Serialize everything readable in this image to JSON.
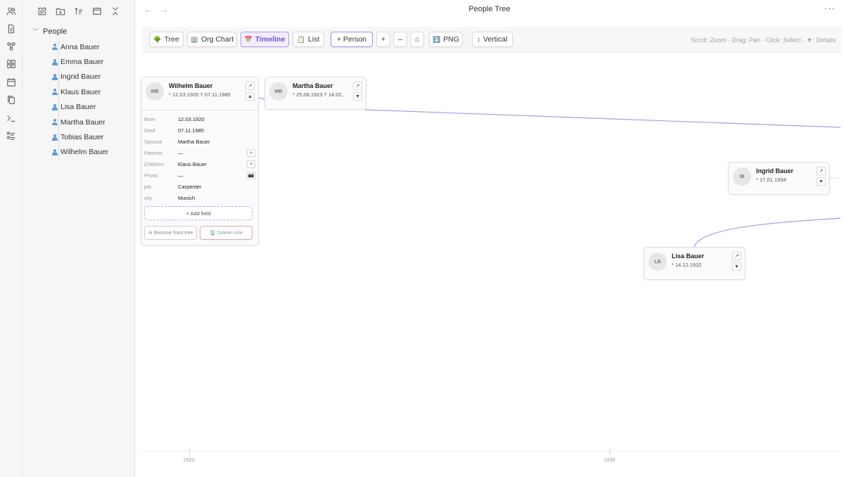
{
  "ribbon": {
    "icons": [
      "people-icon",
      "file-icon",
      "graph-icon",
      "grid-icon",
      "calendar-icon",
      "copy-icon",
      "terminal-icon",
      "list-icon"
    ]
  },
  "sidebar": {
    "tools": [
      "new-note-icon",
      "new-folder-icon",
      "sort-icon",
      "collapse-view-icon",
      "collapse-all-icon"
    ],
    "folder": {
      "name": "People",
      "expanded": true
    },
    "people": [
      "Anna Bauer",
      "Emma Bauer",
      "Ingrid Bauer",
      "Klaus Bauer",
      "Lisa Bauer",
      "Martha Bauer",
      "Tobias Bauer",
      "Wilhelm Bauer"
    ]
  },
  "header": {
    "back": "←",
    "forward": "→",
    "title": "People Tree",
    "more": "···"
  },
  "toolbar": {
    "tree": {
      "icon": "🌳",
      "label": "Tree"
    },
    "org_chart": {
      "icon": "🏢",
      "label": "Org Chart"
    },
    "timeline": {
      "icon": "📅",
      "label": "Timeline"
    },
    "list": {
      "icon": "📋",
      "label": "List"
    },
    "add_person": "+ Person",
    "zoom_in": "+",
    "zoom_out": "–",
    "home": "⌂",
    "png": {
      "icon": "⬇️",
      "label": "PNG"
    },
    "vertical": {
      "icon": "↕",
      "label": "Vertical"
    },
    "hint": "Scroll: Zoom · Drag: Pan · Click: Select · ▼: Details",
    "active_view": "Timeline",
    "accent_color": "#7c5ce0"
  },
  "cards": {
    "wilhelm": {
      "initials": "WB",
      "name": "Wilhelm Bauer",
      "dates": "* 12.03.1920 † 07.11.1985",
      "open": "↗",
      "toggle": "▲",
      "fields": {
        "born": {
          "label": "Born",
          "value": "12.03.1920"
        },
        "died": {
          "label": "Died",
          "value": "07.11.1985"
        },
        "spouse": {
          "label": "Spouse",
          "value": "Martha Bauer"
        },
        "parents": {
          "label": "Parents",
          "value": "—",
          "action": "+"
        },
        "children": {
          "label": "Children",
          "value": "Klaus Bauer",
          "action": "+"
        },
        "photo": {
          "label": "Photo",
          "value": "—",
          "action": "📷"
        },
        "job": {
          "label": "job",
          "value": "Carpenter"
        },
        "city": {
          "label": "city",
          "value": "Munich"
        }
      },
      "add_field": "+ Add field",
      "remove": "⊖ Remove from tree",
      "delete": "🗑️ Delete note"
    },
    "martha": {
      "initials": "MB",
      "name": "Martha Bauer",
      "dates": "* 25.08.1923 † 14.02...",
      "open": "↗",
      "toggle": "▼"
    },
    "ingrid": {
      "initials": "IB",
      "name": "Ingrid Bauer",
      "dates": "* 17.01.1934",
      "open": "↗",
      "toggle": "▼"
    },
    "lisa": {
      "initials": "LB",
      "name": "Lisa Bauer",
      "dates": "* 14.12.1932",
      "open": "↗",
      "toggle": "▼"
    }
  },
  "timeline": {
    "ticks": [
      "1920",
      "1930"
    ],
    "connector_color": "#a79be6"
  }
}
